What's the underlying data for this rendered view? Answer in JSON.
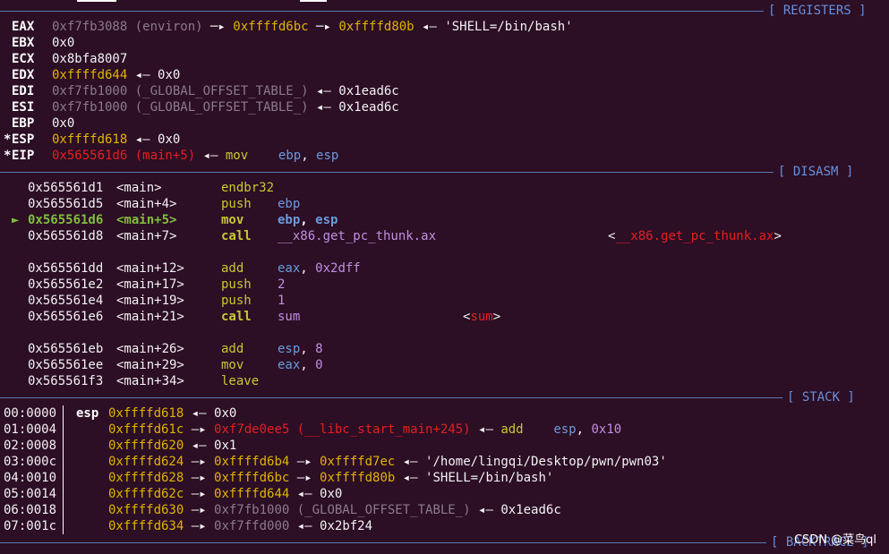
{
  "headers": {
    "registers": "[ REGISTERS ]",
    "disasm": "[ DISASM ]",
    "stack": "[ STACK ]",
    "backtrace": "[ BACKTRACE ]"
  },
  "registers": [
    {
      "star": " ",
      "name": "EAX",
      "segs": [
        {
          "t": "0xf7fb3088 (environ)",
          "c": "c-gr"
        },
        {
          "t": " ─▸ ",
          "c": "c-w"
        },
        {
          "t": "0xffffd6bc",
          "c": "c-ye"
        },
        {
          "t": " ─▸ ",
          "c": "c-w"
        },
        {
          "t": "0xffffd80b",
          "c": "c-ye"
        },
        {
          "t": " ◂— ",
          "c": "c-w"
        },
        {
          "t": "'SHELL=/bin/bash'",
          "c": "c-w"
        }
      ]
    },
    {
      "star": " ",
      "name": "EBX",
      "segs": [
        {
          "t": "0x0",
          "c": "c-w"
        }
      ]
    },
    {
      "star": " ",
      "name": "ECX",
      "segs": [
        {
          "t": "0x8bfa8007",
          "c": "c-w"
        }
      ]
    },
    {
      "star": " ",
      "name": "EDX",
      "segs": [
        {
          "t": "0xffffd644",
          "c": "c-ye"
        },
        {
          "t": " ◂— ",
          "c": "c-w"
        },
        {
          "t": "0x0",
          "c": "c-w"
        }
      ]
    },
    {
      "star": " ",
      "name": "EDI",
      "segs": [
        {
          "t": "0xf7fb1000 (_GLOBAL_OFFSET_TABLE_)",
          "c": "c-gr"
        },
        {
          "t": " ◂— ",
          "c": "c-w"
        },
        {
          "t": "0x1ead6c",
          "c": "c-w"
        }
      ]
    },
    {
      "star": " ",
      "name": "ESI",
      "segs": [
        {
          "t": "0xf7fb1000 (_GLOBAL_OFFSET_TABLE_)",
          "c": "c-gr"
        },
        {
          "t": " ◂— ",
          "c": "c-w"
        },
        {
          "t": "0x1ead6c",
          "c": "c-w"
        }
      ]
    },
    {
      "star": " ",
      "name": "EBP",
      "segs": [
        {
          "t": "0x0",
          "c": "c-w"
        }
      ]
    },
    {
      "star": "*",
      "name": "ESP",
      "segs": [
        {
          "t": "0xffffd618",
          "c": "c-ye"
        },
        {
          "t": " ◂— ",
          "c": "c-w"
        },
        {
          "t": "0x0",
          "c": "c-w"
        }
      ]
    },
    {
      "star": "*",
      "name": "EIP",
      "segs": [
        {
          "t": "0x565561d6 (main+5)",
          "c": "c-rd"
        },
        {
          "t": " ◂— ",
          "c": "c-w"
        },
        {
          "t": "mov",
          "c": "c-yg"
        },
        {
          "t": "    ",
          "c": "c-w"
        },
        {
          "t": "ebp",
          "c": "c-bl"
        },
        {
          "t": ", ",
          "c": "c-w"
        },
        {
          "t": "esp",
          "c": "c-bl"
        }
      ]
    }
  ],
  "disasm": [
    {
      "marker": "",
      "addr": "0x565561d1",
      "sym": "<main>",
      "op": "endbr32",
      "args": [],
      "ref": null,
      "current": false
    },
    {
      "marker": "",
      "addr": "0x565561d5",
      "sym": "<main+4>",
      "op": "push",
      "args": [
        {
          "t": "ebp",
          "c": "c-bl"
        }
      ],
      "ref": null,
      "current": false
    },
    {
      "marker": "►",
      "addr": "0x565561d6",
      "sym": "<main+5>",
      "op": "mov",
      "args": [
        {
          "t": "ebp",
          "c": "c-blb"
        },
        {
          "t": ", ",
          "c": "c-bw"
        },
        {
          "t": "esp",
          "c": "c-blb"
        }
      ],
      "ref": null,
      "current": true
    },
    {
      "marker": "",
      "addr": "0x565561d8",
      "sym": "<main+7>",
      "op": "call",
      "args": [
        {
          "t": "__x86.get_pc_thunk.ax",
          "c": "c-mv"
        }
      ],
      "ref": "__x86.get_pc_thunk.ax",
      "refx": 679,
      "current": false,
      "opbold": true
    },
    {
      "blank": true
    },
    {
      "marker": "",
      "addr": "0x565561dd",
      "sym": "<main+12>",
      "op": "add",
      "args": [
        {
          "t": "eax",
          "c": "c-bl"
        },
        {
          "t": ", ",
          "c": "c-w"
        },
        {
          "t": "0x2dff",
          "c": "c-mv"
        }
      ],
      "ref": null,
      "current": false
    },
    {
      "marker": "",
      "addr": "0x565561e2",
      "sym": "<main+17>",
      "op": "push",
      "args": [
        {
          "t": "2",
          "c": "c-mv"
        }
      ],
      "ref": null,
      "current": false
    },
    {
      "marker": "",
      "addr": "0x565561e4",
      "sym": "<main+19>",
      "op": "push",
      "args": [
        {
          "t": "1",
          "c": "c-mv"
        }
      ],
      "ref": null,
      "current": false
    },
    {
      "marker": "",
      "addr": "0x565561e6",
      "sym": "<main+21>",
      "op": "call",
      "args": [
        {
          "t": "sum",
          "c": "c-mv"
        }
      ],
      "ref": "sum",
      "refx": 517,
      "current": false,
      "opbold": true
    },
    {
      "blank": true
    },
    {
      "marker": "",
      "addr": "0x565561eb",
      "sym": "<main+26>",
      "op": "add",
      "args": [
        {
          "t": "esp",
          "c": "c-bl"
        },
        {
          "t": ", ",
          "c": "c-w"
        },
        {
          "t": "8",
          "c": "c-mv"
        }
      ],
      "ref": null,
      "current": false
    },
    {
      "marker": "",
      "addr": "0x565561ee",
      "sym": "<main+29>",
      "op": "mov",
      "args": [
        {
          "t": "eax",
          "c": "c-bl"
        },
        {
          "t": ", ",
          "c": "c-w"
        },
        {
          "t": "0",
          "c": "c-mv"
        }
      ],
      "ref": null,
      "current": false
    },
    {
      "marker": "",
      "addr": "0x565561f3",
      "sym": "<main+34>",
      "op": "leave",
      "args": [],
      "ref": null,
      "current": false
    }
  ],
  "stack": [
    {
      "idx": "00:0000",
      "reg": "esp",
      "segs": [
        {
          "t": "0xffffd618",
          "c": "c-ye"
        },
        {
          "t": " ◂— ",
          "c": "c-w"
        },
        {
          "t": "0x0",
          "c": "c-w"
        }
      ]
    },
    {
      "idx": "01:0004",
      "reg": "",
      "segs": [
        {
          "t": "0xffffd61c",
          "c": "c-ye"
        },
        {
          "t": " —▸ ",
          "c": "c-w"
        },
        {
          "t": "0xf7de0ee5 (__libc_start_main+245)",
          "c": "c-rd"
        },
        {
          "t": " ◂— ",
          "c": "c-w"
        },
        {
          "t": "add",
          "c": "c-yg"
        },
        {
          "t": "    ",
          "c": "c-w"
        },
        {
          "t": "esp",
          "c": "c-bl"
        },
        {
          "t": ", ",
          "c": "c-w"
        },
        {
          "t": "0x10",
          "c": "c-mv"
        }
      ]
    },
    {
      "idx": "02:0008",
      "reg": "",
      "segs": [
        {
          "t": "0xffffd620",
          "c": "c-ye"
        },
        {
          "t": " ◂— ",
          "c": "c-w"
        },
        {
          "t": "0x1",
          "c": "c-w"
        }
      ]
    },
    {
      "idx": "03:000c",
      "reg": "",
      "segs": [
        {
          "t": "0xffffd624",
          "c": "c-ye"
        },
        {
          "t": " —▸ ",
          "c": "c-w"
        },
        {
          "t": "0xffffd6b4",
          "c": "c-ye"
        },
        {
          "t": " —▸ ",
          "c": "c-w"
        },
        {
          "t": "0xffffd7ec",
          "c": "c-ye"
        },
        {
          "t": " ◂— ",
          "c": "c-w"
        },
        {
          "t": "'/home/lingqi/Desktop/pwn/pwn03'",
          "c": "c-w"
        }
      ]
    },
    {
      "idx": "04:0010",
      "reg": "",
      "segs": [
        {
          "t": "0xffffd628",
          "c": "c-ye"
        },
        {
          "t": " —▸ ",
          "c": "c-w"
        },
        {
          "t": "0xffffd6bc",
          "c": "c-ye"
        },
        {
          "t": " —▸ ",
          "c": "c-w"
        },
        {
          "t": "0xffffd80b",
          "c": "c-ye"
        },
        {
          "t": " ◂— ",
          "c": "c-w"
        },
        {
          "t": "'SHELL=/bin/bash'",
          "c": "c-w"
        }
      ]
    },
    {
      "idx": "05:0014",
      "reg": "",
      "segs": [
        {
          "t": "0xffffd62c",
          "c": "c-ye"
        },
        {
          "t": " —▸ ",
          "c": "c-w"
        },
        {
          "t": "0xffffd644",
          "c": "c-ye"
        },
        {
          "t": " ◂— ",
          "c": "c-w"
        },
        {
          "t": "0x0",
          "c": "c-w"
        }
      ]
    },
    {
      "idx": "06:0018",
      "reg": "",
      "segs": [
        {
          "t": "0xffffd630",
          "c": "c-ye"
        },
        {
          "t": " —▸ ",
          "c": "c-w"
        },
        {
          "t": "0xf7fb1000 (_GLOBAL_OFFSET_TABLE_)",
          "c": "c-gr"
        },
        {
          "t": " ◂— ",
          "c": "c-w"
        },
        {
          "t": "0x1ead6c",
          "c": "c-w"
        }
      ]
    },
    {
      "idx": "07:001c",
      "reg": "",
      "segs": [
        {
          "t": "0xffffd634",
          "c": "c-ye"
        },
        {
          "t": " —▸ ",
          "c": "c-w"
        },
        {
          "t": "0xf7ffd000",
          "c": "c-gr"
        },
        {
          "t": " ◂— ",
          "c": "c-w"
        },
        {
          "t": "0x2bf24",
          "c": "c-w"
        }
      ]
    }
  ],
  "watermark": "CSDN @菜鸟ql"
}
